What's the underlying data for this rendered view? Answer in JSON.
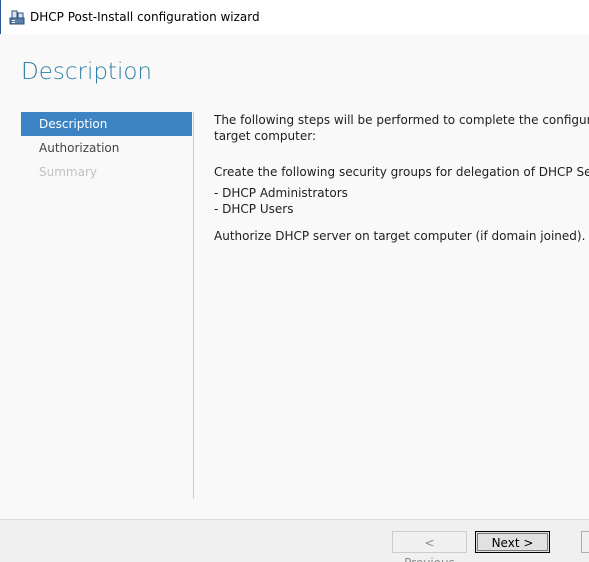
{
  "window": {
    "title": "DHCP Post-Install configuration wizard"
  },
  "page": {
    "heading": "Description"
  },
  "steps": [
    {
      "label": "Description",
      "state": "selected"
    },
    {
      "label": "Authorization",
      "state": "enabled"
    },
    {
      "label": "Summary",
      "state": "disabled"
    }
  ],
  "content": {
    "intro_line1": "The following steps will be performed to complete the configuration of",
    "intro_line2": "target computer:",
    "groups_intro": "Create the following security groups for delegation of DHCP Server Adm",
    "groups": [
      "- DHCP Administrators",
      "- DHCP Users"
    ],
    "authorize": "Authorize DHCP server on target computer (if domain joined)."
  },
  "buttons": {
    "previous": "< Previous",
    "next": "Next >"
  },
  "colors": {
    "accent": "#3c83c4",
    "heading": "#2f7fa6"
  },
  "icons": {
    "title": "dhcp-server-icon"
  }
}
